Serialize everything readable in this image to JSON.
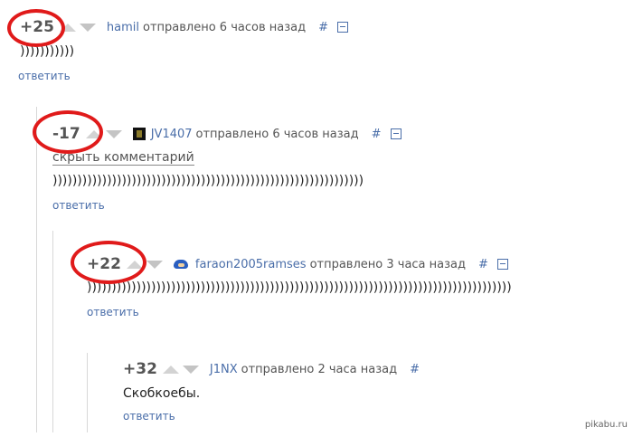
{
  "comments": [
    {
      "rating": "+25",
      "user": "hamil",
      "posted": "отправлено 6 часов назад",
      "hash": "#",
      "text": ")))))))))))",
      "reply": "ответить"
    },
    {
      "rating": "-17",
      "user": "JV1407",
      "posted": "отправлено 6 часов назад",
      "hash": "#",
      "hide": "скрыть комментарий",
      "text": ")))))))))))))))))))))))))))))))))))))))))))))))))))))))))))))))",
      "reply": "ответить"
    },
    {
      "rating": "+22",
      "user": "faraon2005ramses",
      "posted": "отправлено 3 часа назад",
      "hash": "#",
      "text": "))))))))))))))))))))))))))))))))))))))))))))))))))))))))))))))))))))))))))))))))))))))",
      "reply": "ответить"
    },
    {
      "rating": "+32",
      "user": "J1NX",
      "posted": "отправлено 2 часа назад",
      "hash": "#",
      "text": "Скобкоебы.",
      "reply": "ответить"
    }
  ],
  "watermark": "pikabu.ru",
  "colors": {
    "link": "#4a6ea9",
    "highlight_circle": "#e01a1a"
  }
}
